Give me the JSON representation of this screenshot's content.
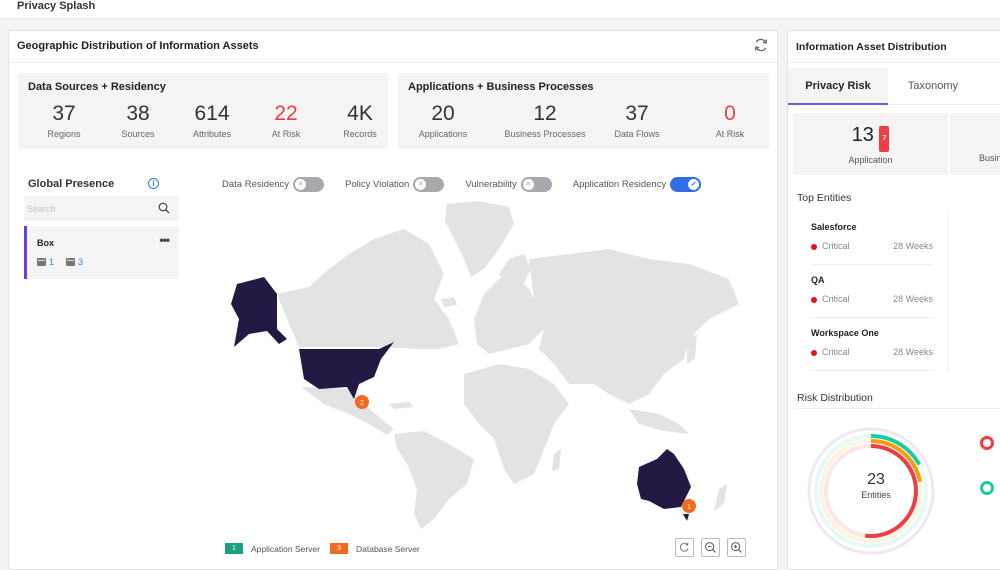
{
  "app": {
    "title": "Privacy Splash"
  },
  "geo": {
    "title": "Geographic Distribution of Information Assets",
    "refresh_icon": "refresh-icon",
    "data_sources": {
      "title": "Data Sources + Residency",
      "stats": [
        {
          "value": "37",
          "label": "Regions",
          "alert": false
        },
        {
          "value": "38",
          "label": "Sources",
          "alert": false
        },
        {
          "value": "614",
          "label": "Attributes",
          "alert": false
        },
        {
          "value": "22",
          "label": "At Risk",
          "alert": true
        },
        {
          "value": "4K",
          "label": "Records",
          "alert": false
        }
      ]
    },
    "applications": {
      "title": "Applications + Business Processes",
      "stats": [
        {
          "value": "20",
          "label": "Applications",
          "alert": false
        },
        {
          "value": "12",
          "label": "Business Processes",
          "alert": false
        },
        {
          "value": "37",
          "label": "Data Flows",
          "alert": false
        },
        {
          "value": "0",
          "label": "At Risk",
          "alert": true
        }
      ]
    },
    "global_presence": {
      "title": "Global Presence",
      "search_placeholder": "Search",
      "items": [
        {
          "name": "Box",
          "app_servers": "1",
          "db_servers": "3"
        }
      ]
    },
    "toggles": [
      {
        "label": "Data Residency",
        "on": false
      },
      {
        "label": "Policy Violation",
        "on": false
      },
      {
        "label": "Vulnerability",
        "on": false
      },
      {
        "label": "Application Residency",
        "on": true
      }
    ],
    "map": {
      "highlighted_regions": [
        "United States",
        "Australia"
      ],
      "markers": [
        {
          "region": "United States",
          "count": "2"
        },
        {
          "region": "Australia",
          "count": "1"
        }
      ],
      "highlight_color": "#231942",
      "land_color": "#e3e3e3",
      "marker_color": "#f26a21"
    },
    "legend": [
      {
        "count": "1",
        "label": "Application Server",
        "color": "#1aa082"
      },
      {
        "count": "3",
        "label": "Database Server",
        "color": "#f26a21"
      }
    ],
    "map_controls": [
      "reset-icon",
      "zoom-out-icon",
      "zoom-in-icon"
    ]
  },
  "iad": {
    "title": "Information Asset Distribution",
    "tabs": [
      {
        "label": "Privacy Risk",
        "active": true
      },
      {
        "label": "Taxonomy",
        "active": false
      }
    ],
    "kpis": [
      {
        "value": "13",
        "badge": "7",
        "label": "Application"
      },
      {
        "label": "Busin"
      }
    ],
    "top_entities_title": "Top Entities",
    "top_entities": [
      {
        "name": "Salesforce",
        "severity": "Critical",
        "age": "28 Weeks"
      },
      {
        "name": "QA",
        "severity": "Critical",
        "age": "28 Weeks"
      },
      {
        "name": "Workspace One",
        "severity": "Critical",
        "age": "28 Weeks"
      }
    ],
    "risk_distribution": {
      "title": "Risk Distribution",
      "total": "23",
      "total_label": "Entities",
      "rings": [
        {
          "color": "#1cc9a0",
          "fraction": 0.17
        },
        {
          "color": "#f59c0b",
          "fraction": 0.22
        },
        {
          "color": "#ef3e42",
          "fraction": 0.52
        }
      ],
      "legend_colors": [
        "#ef3e42",
        "#1cc9a0"
      ]
    }
  }
}
